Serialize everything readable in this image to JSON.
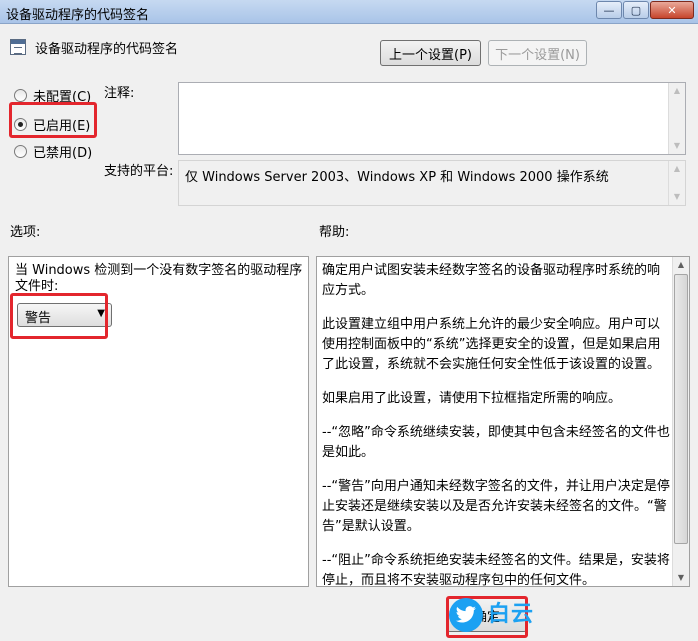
{
  "window": {
    "title": "设备驱动程序的代码签名",
    "min_glyph": "—",
    "max_glyph": "▢",
    "close_glyph": "✕"
  },
  "header": {
    "policy_title": "设备驱动程序的代码签名",
    "icon": "policy-setting-icon",
    "prev_button": "上一个设置(P)",
    "next_button": "下一个设置(N)"
  },
  "state": {
    "options": [
      {
        "label": "未配置(C)",
        "checked": false
      },
      {
        "label": "已启用(E)",
        "checked": true
      },
      {
        "label": "已禁用(D)",
        "checked": false
      }
    ]
  },
  "comment": {
    "label": "注释:",
    "value": ""
  },
  "platform": {
    "label": "支持的平台:",
    "value": "仅 Windows Server 2003、Windows XP 和 Windows 2000 操作系统"
  },
  "options_section": {
    "label": "选项:",
    "prompt": "当 Windows 检测到一个没有数字签名的驱动程序文件时:",
    "select_value": "警告"
  },
  "help_section": {
    "label": "帮助:",
    "paragraphs": [
      "确定用户试图安装未经数字签名的设备驱动程序时系统的响应方式。",
      "此设置建立组中用户系统上允许的最少安全响应。用户可以使用控制面板中的“系统”选择更安全的设置，但是如果启用了此设置，系统就不会实施任何安全性低于该设置的设置。",
      "如果启用了此设置，请使用下拉框指定所需的响应。",
      "--“忽略”命令系统继续安装，即使其中包含未经签名的文件也是如此。",
      "--“警告”向用户通知未经数字签名的文件，并让用户决定是停止安装还是继续安装以及是否允许安装未经签名的文件。“警告”是默认设置。",
      "--“阻止”命令系统拒绝安装未经签名的文件。结果是，安装将停止，而且将不安装驱动程序包中的任何文件。"
    ]
  },
  "footer": {
    "ok_button": "确定",
    "watermark_text": "白云",
    "watermark_icon": "twitter-bird-icon"
  },
  "colors": {
    "highlight": "#e3262d",
    "watermark": "#1ca1f2"
  }
}
